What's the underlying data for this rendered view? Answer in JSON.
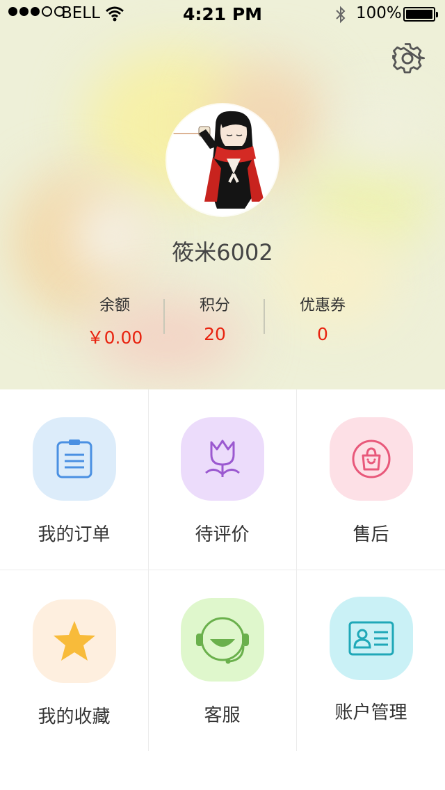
{
  "status_bar": {
    "carrier": "BELL",
    "time": "4:21 PM",
    "battery": "100%"
  },
  "profile": {
    "username": "筱米6002",
    "stats": [
      {
        "label": "余额",
        "value": "￥0.00"
      },
      {
        "label": "积分",
        "value": "20"
      },
      {
        "label": "优惠券",
        "value": "0"
      }
    ]
  },
  "menu": [
    {
      "label": "我的订单",
      "icon": "order-list-icon",
      "tile_color": "#dcecfa",
      "icon_color": "#4a90e2"
    },
    {
      "label": "待评价",
      "icon": "tulip-icon",
      "tile_color": "#ecdcfb",
      "icon_color": "#9b59d0"
    },
    {
      "label": "售后",
      "icon": "shopping-bag-icon",
      "tile_color": "#fde0e6",
      "icon_color": "#e8587a"
    },
    {
      "label": "我的收藏",
      "icon": "star-icon",
      "tile_color": "#feefdf",
      "icon_color": "#f5b830"
    },
    {
      "label": "客服",
      "icon": "headset-icon",
      "tile_color": "#dff7cc",
      "icon_color": "#6ab04c"
    },
    {
      "label": "账户管理",
      "icon": "id-card-icon",
      "tile_color": "#caf1f6",
      "icon_color": "#1fa8b8"
    }
  ],
  "colors": {
    "accent_red": "#e8220f"
  }
}
